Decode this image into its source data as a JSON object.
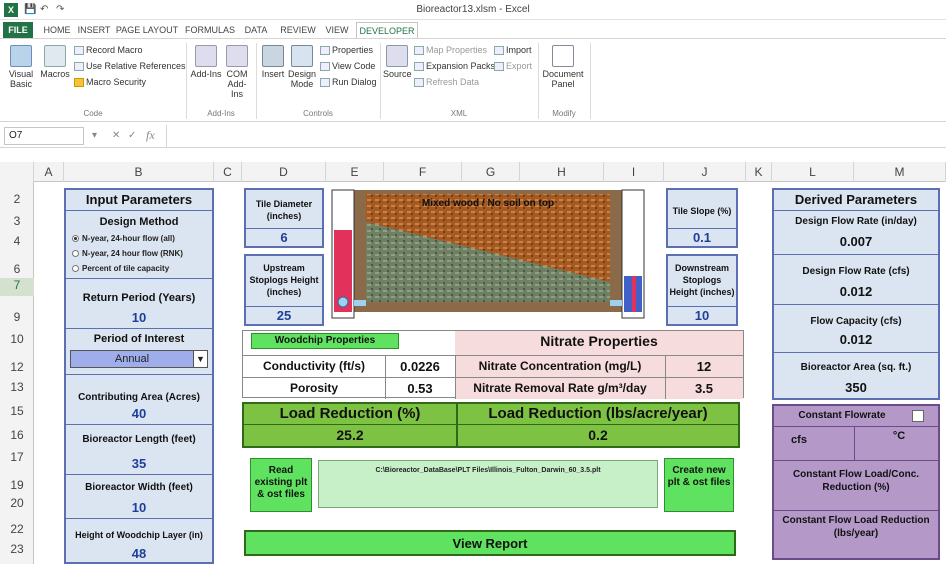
{
  "window": {
    "title": "Bioreactor13.xlsm - Excel",
    "app_icon": "X",
    "qat": [
      "save-icon",
      "undo-icon",
      "redo-icon"
    ]
  },
  "tabs": [
    "FILE",
    "HOME",
    "INSERT",
    "PAGE LAYOUT",
    "FORMULAS",
    "DATA",
    "REVIEW",
    "VIEW",
    "DEVELOPER"
  ],
  "ribbon": {
    "code": {
      "visual_basic": "Visual Basic",
      "macros": "Macros",
      "record": "Record Macro",
      "relative": "Use Relative References",
      "security": "Macro Security",
      "label": "Code"
    },
    "addins": {
      "addins": "Add-Ins",
      "com": "COM Add-Ins",
      "label": "Add-Ins"
    },
    "controls": {
      "insert": "Insert",
      "design": "Design Mode",
      "properties": "Properties",
      "view_code": "View Code",
      "run_dialog": "Run Dialog",
      "label": "Controls"
    },
    "xml": {
      "source": "Source",
      "map": "Map Properties",
      "expansion": "Expansion Packs",
      "refresh": "Refresh Data",
      "import": "Import",
      "export": "Export",
      "label": "XML"
    },
    "modify": {
      "doc_panel": "Document Panel",
      "label": "Modify"
    }
  },
  "formula_bar": {
    "name_box": "O7",
    "fx": "fx",
    "formula": ""
  },
  "columns": [
    "A",
    "B",
    "C",
    "D",
    "E",
    "F",
    "G",
    "H",
    "I",
    "J",
    "K",
    "L",
    "M"
  ],
  "rows": [
    "2",
    "3",
    "4",
    "6",
    "7",
    "9",
    "10",
    "12",
    "13",
    "15",
    "16",
    "17",
    "19",
    "20",
    "22",
    "23"
  ],
  "selected_row": "7",
  "input": {
    "title": "Input Parameters",
    "design_method_label": "Design Method",
    "radios": [
      "N-year, 24-hour flow (all)",
      "N-year, 24 hour flow (RNK)",
      "Percent of tile capacity"
    ],
    "return_period_label": "Return Period (Years)",
    "return_period": "10",
    "period_label": "Period of Interest",
    "period_value": "Annual",
    "area_label": "Contributing Area (Acres)",
    "area": "40",
    "length_label": "Bioreactor Length (feet)",
    "length": "35",
    "width_label": "Bioreactor Width (feet)",
    "width": "10",
    "height_label": "Height of Woodchip Layer (in)",
    "height": "48"
  },
  "tile_diameter": {
    "label": "Tile Diameter (inches)",
    "value": "6"
  },
  "upstream": {
    "label": "Upstream Stoplogs Height (inches)",
    "value": "25"
  },
  "tile_slope": {
    "label": "Tile Slope (%)",
    "value": "0.1"
  },
  "downstream": {
    "label": "Downstream Stoplogs Height (inches)",
    "value": "10"
  },
  "diagram_caption": "Mixed wood / No soil on top",
  "woodchip": {
    "button": "Woodchip Properties",
    "conductivity_label": "Conductivity (ft/s)",
    "conductivity": "0.0226",
    "porosity_label": "Porosity",
    "porosity": "0.53"
  },
  "nitrate": {
    "title": "Nitrate Properties",
    "conc_label": "Nitrate Concentration (mg/L)",
    "conc": "12",
    "rate_label": "Nitrate Removal Rate g/m³/day",
    "rate": "3.5"
  },
  "load": {
    "pct_label": "Load Reduction (%)",
    "pct": "25.2",
    "lbs_label": "Load Reduction (lbs/acre/year)",
    "lbs": "0.2"
  },
  "files": {
    "read_button": "Read existing plt & ost files",
    "path": "C:\\Bioreactor_DataBase\\PLT Files\\Illinois_Fulton_Darwin_60_3.5.plt",
    "create_button": "Create new plt & ost files"
  },
  "view_report": "View Report",
  "derived": {
    "title": "Derived Parameters",
    "flow_in_label": "Design Flow Rate (in/day)",
    "flow_in": "0.007",
    "flow_cfs_label": "Design Flow Rate (cfs)",
    "flow_cfs": "0.012",
    "capacity_label": "Flow Capacity (cfs)",
    "capacity": "0.012",
    "area_label": "Bioreactor Area (sq. ft.)",
    "area": "350"
  },
  "constant": {
    "title": "Constant Flowrate",
    "cfs": "cfs",
    "degc": "°C",
    "conc_label": "Constant Flow Load/Conc. Reduction (%)",
    "lbs_label": "Constant Flow Load Reduction (lbs/year)"
  }
}
